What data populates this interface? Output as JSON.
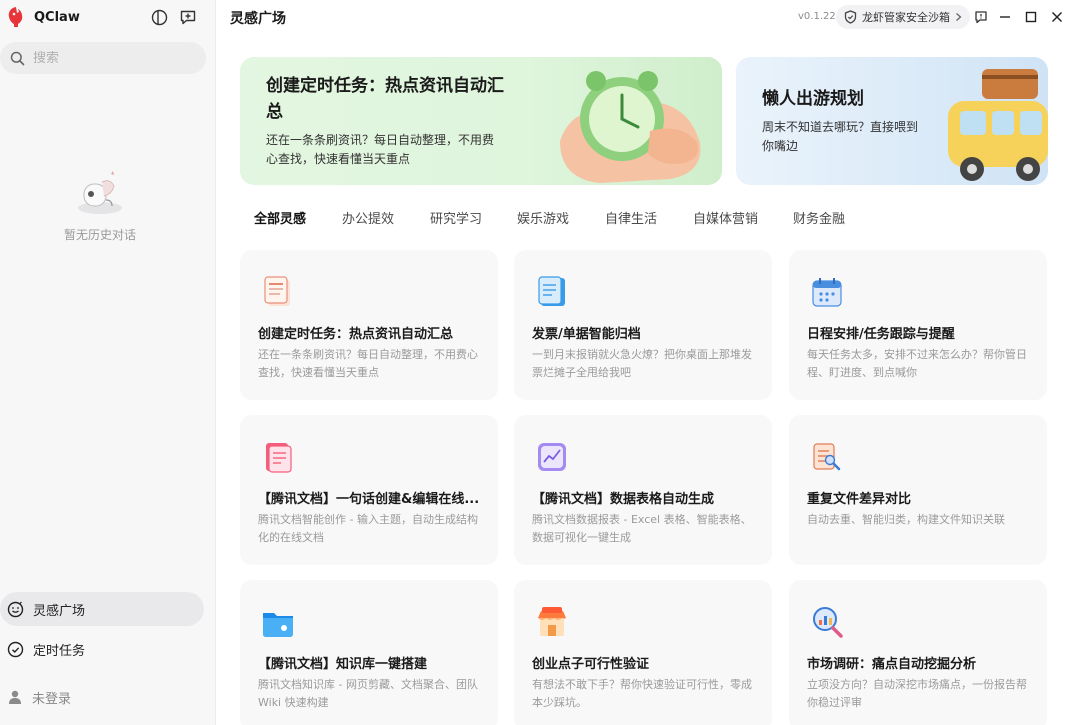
{
  "app": {
    "name": "QClaw"
  },
  "sidebar": {
    "search_placeholder": "搜索",
    "empty_text": "暂无历史对话",
    "nav": [
      {
        "label": "灵感广场",
        "icon": "smile-icon",
        "active": true
      },
      {
        "label": "定时任务",
        "icon": "clock-check-icon",
        "active": false
      },
      {
        "label": "未登录",
        "icon": "user-icon",
        "active": false
      }
    ]
  },
  "topbar": {
    "title": "灵感广场",
    "version": "v0.1.22",
    "security_label": "龙虾管家安全沙箱"
  },
  "banners": [
    {
      "title": "创建定时任务：热点资讯自动汇总",
      "desc": "还在一条条刷资讯？每日自动整理，不用费心查找，快速看懂当天重点",
      "art": "alarm-clock-in-hand"
    },
    {
      "title": "懒人出游规划",
      "desc": "周末不知道去哪玩？直接喂到你嘴边",
      "art": "yellow-van-with-luggage"
    }
  ],
  "tabs": [
    "全部灵感",
    "办公提效",
    "研究学习",
    "娱乐游戏",
    "自律生活",
    "自媒体营销",
    "财务金融"
  ],
  "cards": [
    {
      "title": "创建定时任务：热点资讯自动汇总",
      "desc": "还在一条条刷资讯？每日自动整理，不用费心查找，快速看懂当天重点",
      "icon": "news-document-icon"
    },
    {
      "title": "发票/单据智能归档",
      "desc": "一到月末报销就火急火燎？把你桌面上那堆发票烂摊子全甩给我吧",
      "icon": "notepad-icon"
    },
    {
      "title": "日程安排/任务跟踪与提醒",
      "desc": "每天任务太多，安排不过来怎么办？帮你管日程、盯进度、到点喊你",
      "icon": "calendar-icon"
    },
    {
      "title": "【腾讯文档】一句话创建&编辑在线...",
      "desc": "腾讯文档智能创作 - 输入主题，自动生成结构化的在线文档",
      "icon": "doc-edit-icon"
    },
    {
      "title": "【腾讯文档】数据表格自动生成",
      "desc": "腾讯文档数据报表 - Excel 表格、智能表格、数据可视化一键生成",
      "icon": "chart-card-icon"
    },
    {
      "title": "重复文件差异对比",
      "desc": "自动去重、智能归类，构建文件知识关联",
      "icon": "file-compare-icon"
    },
    {
      "title": "【腾讯文档】知识库一键搭建",
      "desc": "腾讯文档知识库 - 网页剪藏、文档聚合、团队Wiki 快速构建",
      "icon": "folder-icon"
    },
    {
      "title": "创业点子可行性验证",
      "desc": "有想法不敢下手？帮你快速验证可行性，零成本少踩坑。",
      "icon": "store-icon"
    },
    {
      "title": "市场调研：痛点自动挖掘分析",
      "desc": "立项没方向？自动深挖市场痛点，一份报告帮你稳过评审",
      "icon": "magnifier-chart-icon"
    }
  ],
  "colors": {
    "accent_green": "#dff5dc",
    "accent_blue": "#dcebf8",
    "brand_red": "#e8353a"
  }
}
